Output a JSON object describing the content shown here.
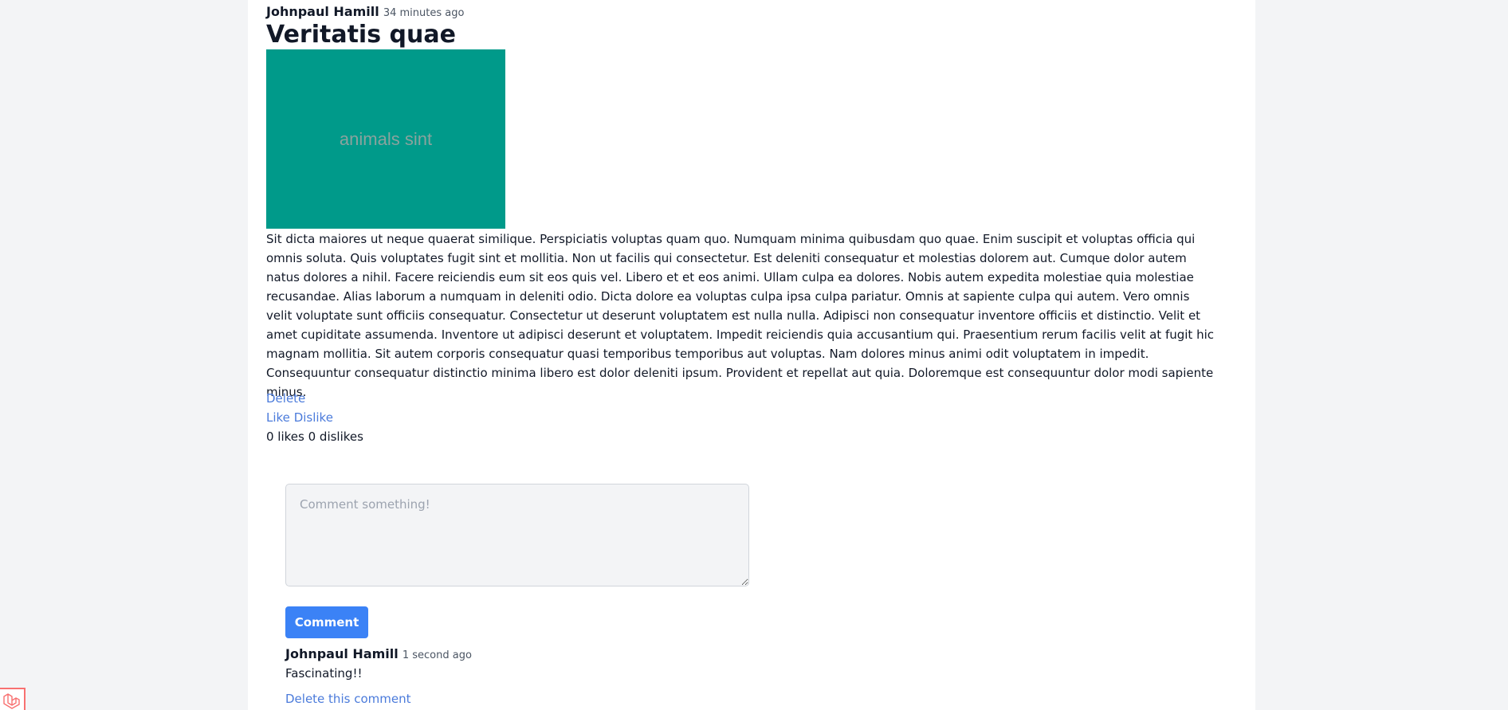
{
  "post": {
    "author": "Johnpaul Hamill",
    "time": "34 minutes ago",
    "title": "Veritatis quae",
    "image_label": "animals sint",
    "body": "Sit dicta maiores ut neque quaerat similique. Perspiciatis voluptas quam quo. Numquam minima quibusdam quo quae. Enim suscipit et voluptas officia qui omnis soluta. Quis voluptates fugit sint et mollitia. Non ut facilis qui consectetur. Est deleniti consequatur et molestias dolorem aut. Cumque dolor autem natus dolores a nihil. Facere reiciendis eum sit eos quis vel. Libero et et eos animi. Ullam culpa ea dolores. Nobis autem expedita molestiae quia molestiae recusandae. Alias laborum a numquam in deleniti odio. Dicta dolore ea voluptas culpa ipsa culpa pariatur. Omnis at sapiente culpa qui autem. Vero omnis velit voluptate sunt officiis consequatur. Consectetur ut deserunt voluptatem est nulla nulla. Adipisci non consequatur inventore officiis et distinctio. Velit et amet cupiditate assumenda. Inventore ut adipisci deserunt et voluptatem. Impedit reiciendis quia accusantium qui. Praesentium rerum facilis velit at fugit hic magnam mollitia. Sit autem corporis consequatur quasi temporibus temporibus aut voluptas. Nam dolores minus animi odit voluptatem in impedit. Consequuntur consequatur distinctio minima libero est dolor deleniti ipsum. Provident et repellat aut quia. Doloremque est consequuntur dolor modi sapiente minus.",
    "delete_label": "Delete",
    "like_label": "Like",
    "dislike_label": "Dislike",
    "counts_text": "0 likes 0 dislikes"
  },
  "comment_form": {
    "placeholder": "Comment something!",
    "value": "",
    "button_label": "Comment"
  },
  "comments": [
    {
      "author": "Johnpaul Hamill",
      "time": "1 second ago",
      "text": "Fascinating!!",
      "delete_label": "Delete this comment"
    }
  ],
  "colors": {
    "page_background": "#f3f4f6",
    "panel_background": "#ffffff",
    "image_placeholder": "#009a8a",
    "link": "#4b7bdb",
    "button": "#3b82f6",
    "logo_accent": "#f87171"
  },
  "icons": {
    "corner_logo": "laravel-logo-icon"
  }
}
